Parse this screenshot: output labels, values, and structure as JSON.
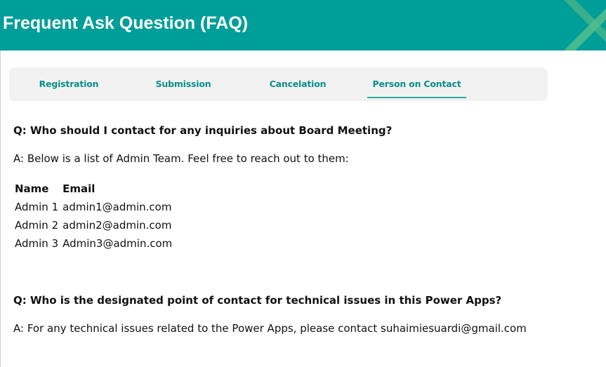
{
  "header": {
    "title": "Frequent Ask Question (FAQ)"
  },
  "tabs": [
    {
      "label": "Registration",
      "active": false
    },
    {
      "label": "Submission",
      "active": false
    },
    {
      "label": "Cancelation",
      "active": false
    },
    {
      "label": "Person on Contact",
      "active": true
    }
  ],
  "faq": [
    {
      "question": "Q: Who should I contact for any inquiries about Board Meeting?",
      "answer": "A: Below is a list of Admin Team. Feel free to reach out to them:"
    },
    {
      "question": "Q: Who is the designated point of contact for technical issues in this Power Apps?",
      "answer": "A: For any technical issues related to the Power Apps, please contact suhaimiesuardi@gmail.com"
    }
  ],
  "admin_table": {
    "headers": {
      "name": "Name",
      "email": "Email"
    },
    "rows": [
      {
        "name": "Admin 1",
        "email": "admin1@admin.com"
      },
      {
        "name": "Admin 2",
        "email": "admin2@admin.com"
      },
      {
        "name": "Admin 3",
        "email": "Admin3@admin.com"
      }
    ]
  },
  "colors": {
    "header_bg": "#009e99",
    "tab_text": "#0a8f8a",
    "tabbar_bg": "#f2f2f2"
  }
}
